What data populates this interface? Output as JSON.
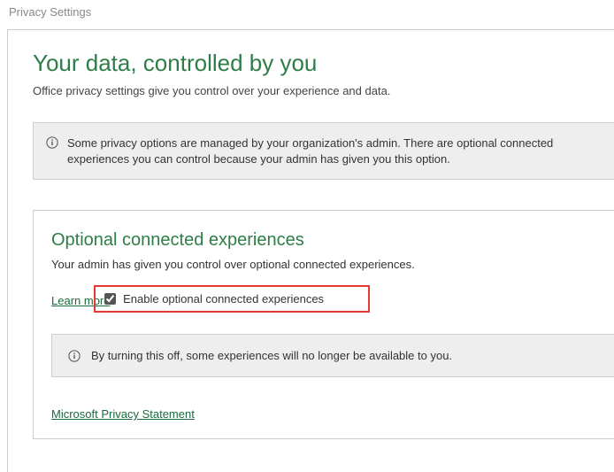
{
  "window": {
    "title": "Privacy Settings"
  },
  "page": {
    "heading": "Your data, controlled by you",
    "subtext": "Office privacy settings give you control over your experience and data."
  },
  "admin_banner": {
    "text": "Some privacy options are managed by your organization's admin. There are optional connected experiences you can control because your admin has given you this option."
  },
  "section": {
    "heading": "Optional connected experiences",
    "text": "Your admin has given you control over optional connected experiences.",
    "learn_more": "Learn more",
    "checkbox_label": "Enable optional connected experiences",
    "checkbox_checked": true,
    "warning": "By turning this off, some experiences will no longer be available to you."
  },
  "footer": {
    "privacy_link": "Microsoft Privacy Statement"
  }
}
